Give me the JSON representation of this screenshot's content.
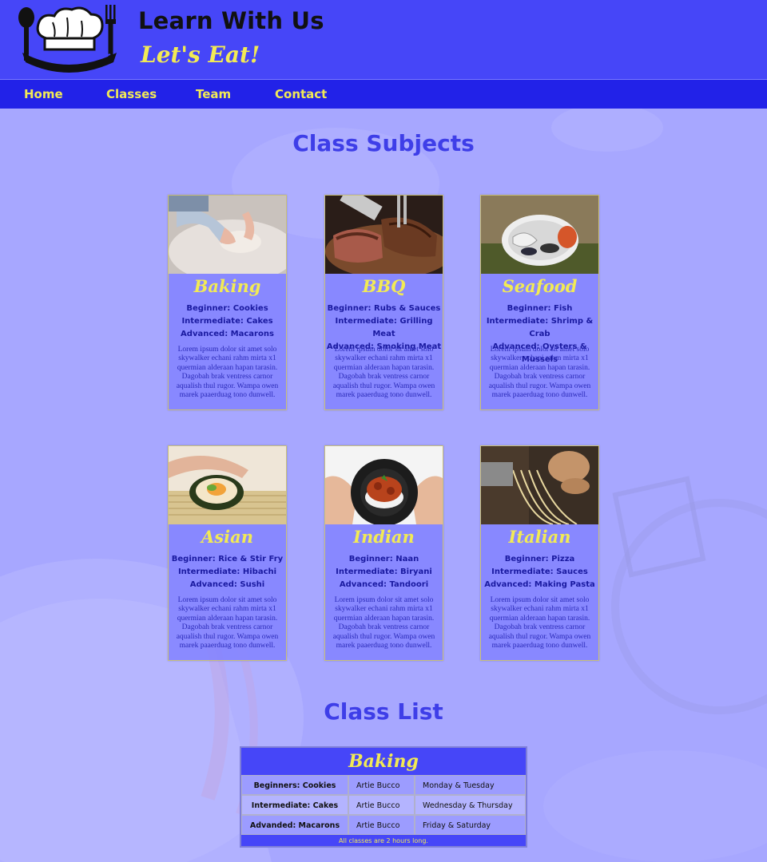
{
  "header": {
    "title": "Learn With Us",
    "tagline": "Let's Eat!"
  },
  "nav": {
    "items": [
      "Home",
      "Classes",
      "Team",
      "Contact"
    ]
  },
  "subjects": {
    "heading": "Class Subjects",
    "cards": [
      {
        "title": "Baking",
        "beginner": "Beginner: Cookies",
        "intermediate": "Intermediate: Cakes",
        "advanced": "Advanced: Macarons"
      },
      {
        "title": "BBQ",
        "beginner": "Beginner: Rubs & Sauces",
        "intermediate": "Intermediate: Grilling Meat",
        "advanced": "Advanced: Smoking Meat"
      },
      {
        "title": "Seafood",
        "beginner": "Beginner: Fish",
        "intermediate": "Intermediate: Shrimp & Crab",
        "advanced": "Advanced: Oysters & Mussels"
      },
      {
        "title": "Asian",
        "beginner": "Beginner: Rice & Stir Fry",
        "intermediate": "Intermediate: Hibachi",
        "advanced": "Advanced: Sushi"
      },
      {
        "title": "Indian",
        "beginner": "Beginner: Naan",
        "intermediate": "Intermediate: Biryani",
        "advanced": "Advanced: Tandoori"
      },
      {
        "title": "Italian",
        "beginner": "Beginner: Pizza",
        "intermediate": "Intermediate: Sauces",
        "advanced": "Advanced: Making Pasta"
      }
    ],
    "description": "Lorem ipsum dolor sit amet solo skywalker echani rahm mirta x1 quermian alderaan hapan tarasin. Dagobah brak ventress carnor aqualish thul rugor. Wampa owen marek paaerduag tono dunwell."
  },
  "class_list": {
    "heading": "Class List",
    "table_title": "Baking",
    "rows": [
      {
        "level": "Beginners: Cookies",
        "instructor": "Artie Bucco",
        "days": "Monday & Tuesday"
      },
      {
        "level": "Intermediate: Cakes",
        "instructor": "Artie Bucco",
        "days": "Wednesday & Thursday"
      },
      {
        "level": "Advanded: Macarons",
        "instructor": "Artie Bucco",
        "days": "Friday & Saturday"
      }
    ],
    "footer": "All classes are 2 hours long."
  },
  "colors": {
    "header_bg": "#4646f8",
    "nav_bg": "#2222e8",
    "accent_yellow": "#f2ea55",
    "page_bg": "#a7a7ff",
    "heading_blue": "#3e3ee8"
  }
}
